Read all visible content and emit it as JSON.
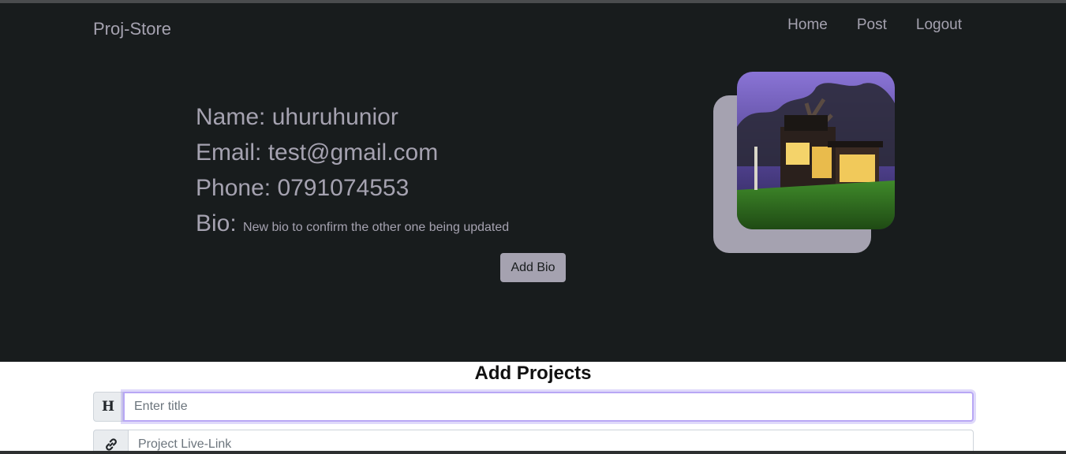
{
  "navbar": {
    "brand": "Proj-Store",
    "links": [
      {
        "label": "Home"
      },
      {
        "label": "Post"
      },
      {
        "label": "Logout"
      }
    ]
  },
  "profile": {
    "name_label": "Name:",
    "name": "uhuruhunior",
    "email_label": "Email:",
    "email": "test@gmail.com",
    "phone_label": "Phone:",
    "phone": "0791074553",
    "bio_label": "Bio:",
    "bio": "New bio to confirm the other one being updated",
    "add_bio_label": "Add Bio"
  },
  "projects_form": {
    "title": "Add Projects",
    "title_field": {
      "icon": "heading-icon",
      "addon_text": "H",
      "placeholder": "Enter title"
    },
    "link_field": {
      "icon": "link-icon",
      "placeholder": "Project Live-Link"
    }
  },
  "colors": {
    "hero_bg": "#181c1d",
    "muted_text": "#a5a2b0",
    "focus_ring": "#b8a7f5"
  }
}
